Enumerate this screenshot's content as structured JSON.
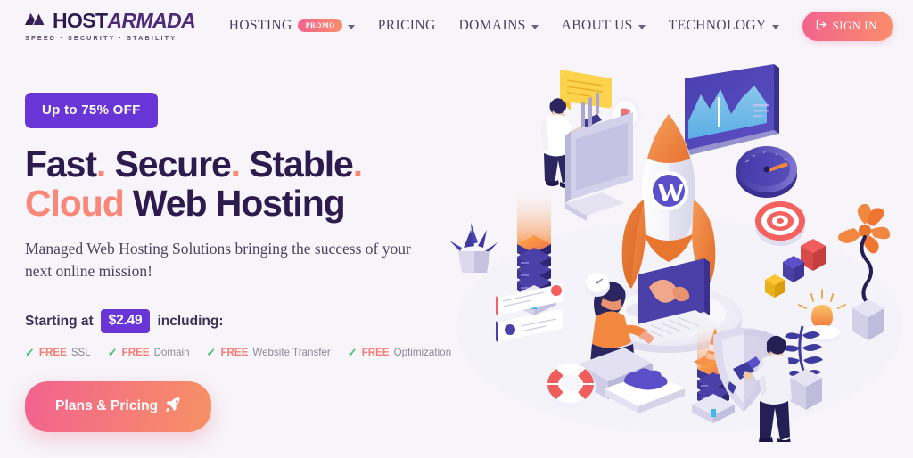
{
  "brand": {
    "logo_host": "HOST",
    "logo_armada": "ARMADA",
    "tagline": "SPEED  ·  SECURITY · STABILITY",
    "logo_icon": "mountain-arrow-icon",
    "accent_purple": "#6a35d6",
    "accent_salmon": "#fa8878",
    "accent_dark": "#2d1b4e",
    "gradient_start": "#f2628f",
    "gradient_end": "#fa8e6a",
    "page_background": "#f7f5fa"
  },
  "nav": {
    "items": [
      {
        "label": "HOSTING",
        "badge": "PROMO",
        "has_caret": true
      },
      {
        "label": "PRICING",
        "badge": null,
        "has_caret": false
      },
      {
        "label": "DOMAINS",
        "badge": null,
        "has_caret": true
      },
      {
        "label": "ABOUT US",
        "badge": null,
        "has_caret": true
      },
      {
        "label": "TECHNOLOGY",
        "badge": null,
        "has_caret": true
      }
    ],
    "signin": {
      "label": "SIGN IN",
      "icon": "sign-in-arrow-icon"
    }
  },
  "hero": {
    "offer_badge": "Up to 75% OFF",
    "headline_line1": [
      {
        "text": "Fast",
        "color": "dark"
      },
      {
        "text": ".",
        "color": "accent"
      },
      {
        "text": " Secure",
        "color": "dark"
      },
      {
        "text": ".",
        "color": "accent"
      },
      {
        "text": " Stable",
        "color": "dark"
      },
      {
        "text": ".",
        "color": "accent"
      }
    ],
    "headline_line1_plain": "Fast. Secure. Stable.",
    "headline_line2_accent": "Cloud",
    "headline_line2_rest": " Web Hosting",
    "subtitle": "Managed Web Hosting Solutions bringing the success of your next online mission!",
    "price_prefix": "Starting at",
    "price_value": "$2.49",
    "price_suffix": "including:",
    "features": [
      {
        "check": "✓",
        "free": "FREE",
        "label": "SSL"
      },
      {
        "check": "✓",
        "free": "FREE",
        "label": "Domain"
      },
      {
        "check": "✓",
        "free": "FREE",
        "label": "Website Transfer"
      },
      {
        "check": "✓",
        "free": "FREE",
        "label": "Optimization"
      }
    ],
    "cta_label": "Plans & Pricing",
    "cta_icon": "rocket-icon"
  },
  "illustration": {
    "name": "isometric-cloud-hosting-scene",
    "elements": [
      "rocket-with-wordpress-logo",
      "launch-platform",
      "standing-man-with-tablet",
      "yellow-chat-bubble",
      "desktop-monitor",
      "purple-server-stack-left",
      "purple-server-stack-right",
      "seated-woman-at-computer",
      "analytics-screen",
      "speedometer-gauge",
      "dartboard-target",
      "color-blocks",
      "lightbulb",
      "orange-flower-plant",
      "purple-fern-plant",
      "succulent-plant",
      "security-shield",
      "man-with-paint-roller",
      "traffic-cone",
      "life-ring",
      "cloud-icon-card",
      "clock-badge",
      "notification-cards"
    ]
  }
}
